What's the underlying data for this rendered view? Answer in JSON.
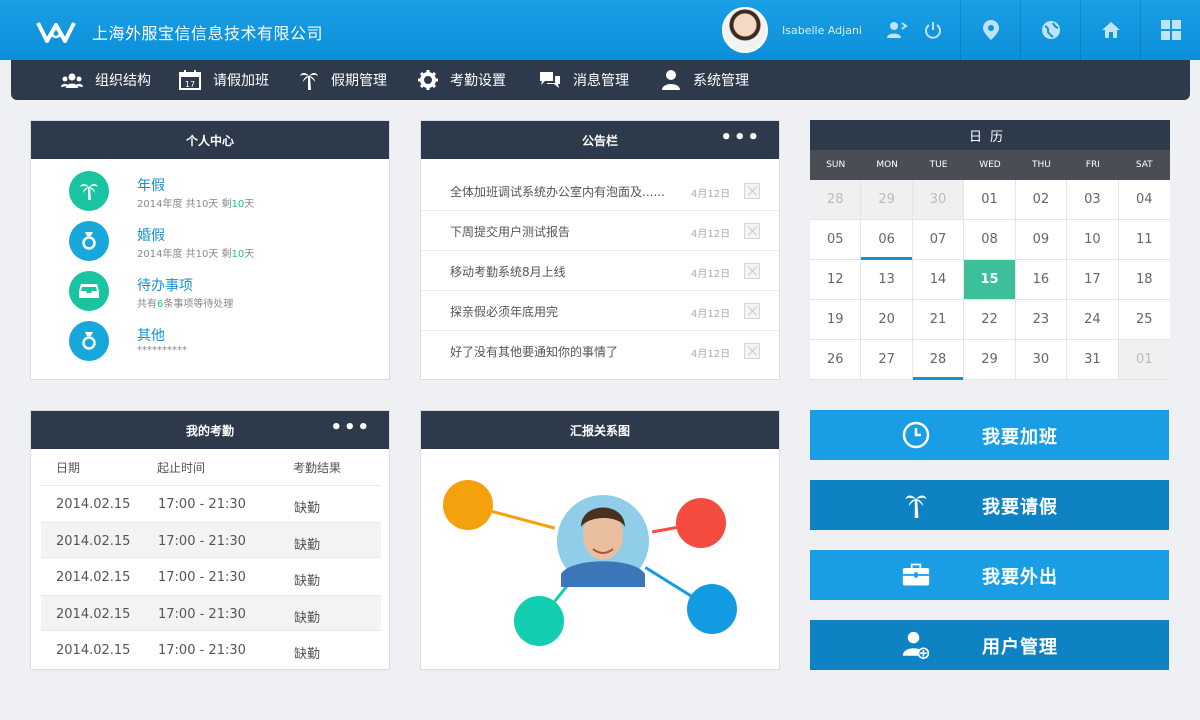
{
  "header": {
    "company": "上海外服宝信信息技术有限公司",
    "username": "Isabelle Adjani"
  },
  "nav": {
    "items": [
      {
        "label": "组织结构",
        "icon": "users-icon"
      },
      {
        "label": "请假加班",
        "icon": "calendar-icon"
      },
      {
        "label": "假期管理",
        "icon": "palm-tree-icon"
      },
      {
        "label": "考勤设置",
        "icon": "gear-icon"
      },
      {
        "label": "消息管理",
        "icon": "chat-icon"
      },
      {
        "label": "系统管理",
        "icon": "user-icon"
      }
    ]
  },
  "personal": {
    "title": "个人中心",
    "items": [
      {
        "title": "年假",
        "sub_a": "2014年度 共10天 剩",
        "sub_hl": "10",
        "sub_b": "天",
        "color": "#19c4a0"
      },
      {
        "title": "婚假",
        "sub_a": "2014年度 共10天 剩",
        "sub_hl": "10",
        "sub_b": "天",
        "color": "#18a7da"
      },
      {
        "title": "待办事项",
        "sub_a": "共有",
        "sub_hl": "6",
        "sub_b": "条事项等待处理",
        "color": "#19c4a0"
      },
      {
        "title": "其他",
        "sub_a": "**********",
        "sub_hl": "",
        "sub_b": "",
        "color": "#18a7da"
      }
    ]
  },
  "notice": {
    "title": "公告栏",
    "more": "•••",
    "items": [
      {
        "text": "全体加班调试系统办公室内有泡面及......",
        "date": "4月12日"
      },
      {
        "text": "下周提交用户测试报告",
        "date": "4月12日"
      },
      {
        "text": "移动考勤系统8月上线",
        "date": "4月12日"
      },
      {
        "text": "探亲假必须年底用完",
        "date": "4月12日"
      },
      {
        "text": "好了没有其他要通知你的事情了",
        "date": "4月12日"
      }
    ]
  },
  "calendar": {
    "title": "日历",
    "weekdays": [
      "SUN",
      "MON",
      "TUE",
      "WED",
      "THU",
      "FRI",
      "SAT"
    ],
    "cells": [
      {
        "d": "28",
        "s": "other"
      },
      {
        "d": "29",
        "s": "other"
      },
      {
        "d": "30",
        "s": "other"
      },
      {
        "d": "01",
        "s": ""
      },
      {
        "d": "02",
        "s": ""
      },
      {
        "d": "03",
        "s": ""
      },
      {
        "d": "04",
        "s": ""
      },
      {
        "d": "05",
        "s": ""
      },
      {
        "d": "06",
        "s": "mark"
      },
      {
        "d": "07",
        "s": ""
      },
      {
        "d": "08",
        "s": ""
      },
      {
        "d": "09",
        "s": ""
      },
      {
        "d": "10",
        "s": ""
      },
      {
        "d": "11",
        "s": ""
      },
      {
        "d": "12",
        "s": ""
      },
      {
        "d": "13",
        "s": ""
      },
      {
        "d": "14",
        "s": ""
      },
      {
        "d": "15",
        "s": "today"
      },
      {
        "d": "16",
        "s": ""
      },
      {
        "d": "17",
        "s": ""
      },
      {
        "d": "18",
        "s": ""
      },
      {
        "d": "19",
        "s": ""
      },
      {
        "d": "20",
        "s": ""
      },
      {
        "d": "21",
        "s": ""
      },
      {
        "d": "22",
        "s": ""
      },
      {
        "d": "23",
        "s": ""
      },
      {
        "d": "24",
        "s": ""
      },
      {
        "d": "25",
        "s": ""
      },
      {
        "d": "26",
        "s": ""
      },
      {
        "d": "27",
        "s": ""
      },
      {
        "d": "28",
        "s": "mark"
      },
      {
        "d": "29",
        "s": ""
      },
      {
        "d": "30",
        "s": ""
      },
      {
        "d": "31",
        "s": ""
      },
      {
        "d": "01",
        "s": "other"
      }
    ]
  },
  "attendance": {
    "title": "我的考勤",
    "more": "•••",
    "headers": [
      "日期",
      "起止时间",
      "考勤结果"
    ],
    "rows": [
      {
        "date": "2014.02.15",
        "time": "17:00 - 21:30",
        "result": "缺勤"
      },
      {
        "date": "2014.02.15",
        "time": "17:00 - 21:30",
        "result": "缺勤"
      },
      {
        "date": "2014.02.15",
        "time": "17:00 - 21:30",
        "result": "缺勤"
      },
      {
        "date": "2014.02.15",
        "time": "17:00 - 21:30",
        "result": "缺勤"
      },
      {
        "date": "2014.02.15",
        "time": "17:00 - 21:30",
        "result": "缺勤"
      }
    ]
  },
  "report": {
    "title": "汇报关系图",
    "node_colors": [
      "#f5a00d",
      "#f44c3f",
      "#12cdb0",
      "#129be3"
    ]
  },
  "actions": [
    {
      "label": "我要加班",
      "icon": "clock-icon",
      "color": "#199ee6"
    },
    {
      "label": "我要请假",
      "icon": "palm-tree-icon",
      "color": "#0e82c3"
    },
    {
      "label": "我要外出",
      "icon": "briefcase-icon",
      "color": "#199ee6"
    },
    {
      "label": "用户管理",
      "icon": "user-add-icon",
      "color": "#0e82c3"
    }
  ]
}
